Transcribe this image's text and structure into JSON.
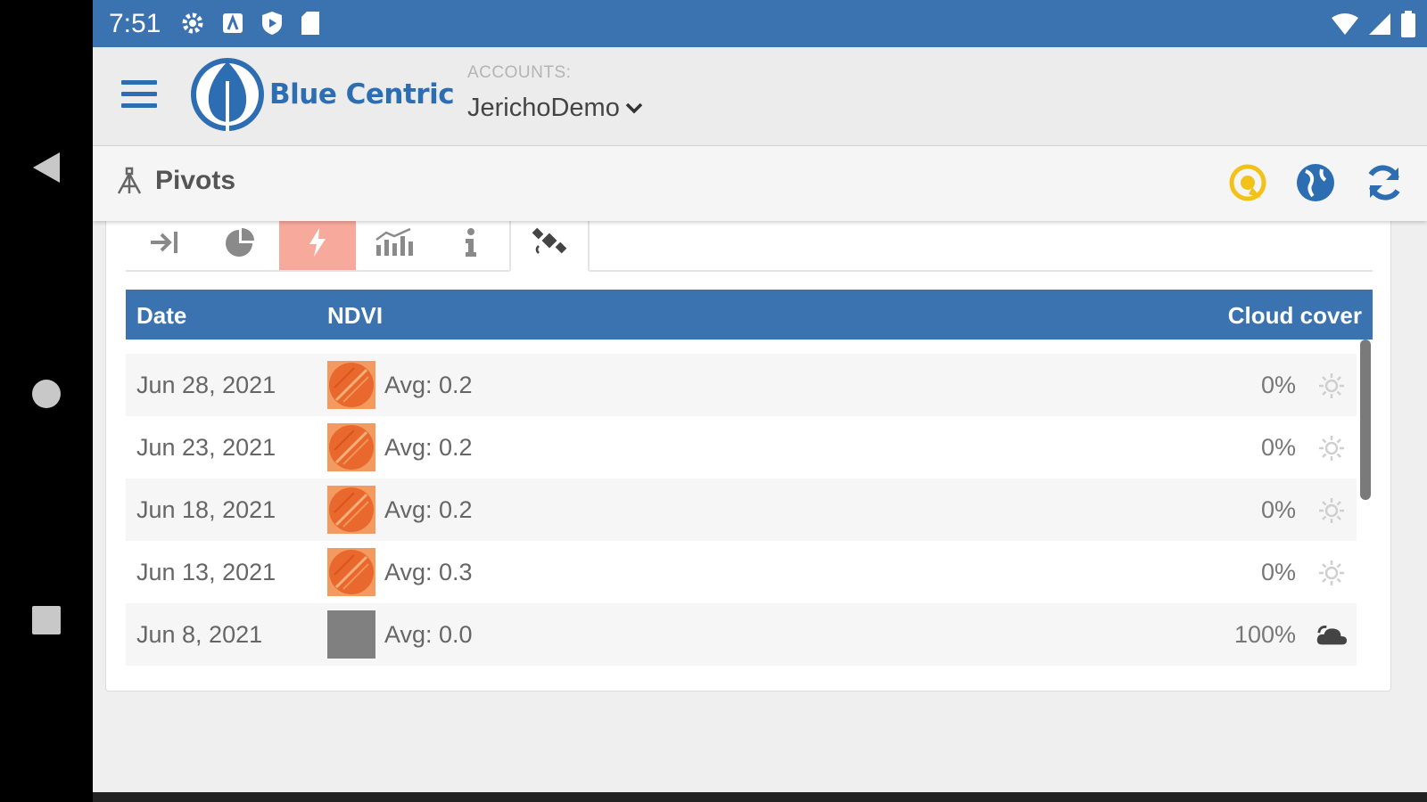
{
  "status_bar": {
    "time": "7:51"
  },
  "header": {
    "logo_text": "Blue Centric",
    "accounts_label": "ACCOUNTS:",
    "account_name": "JerichoDemo"
  },
  "pivots": {
    "title": "Pivots"
  },
  "table": {
    "columns": {
      "date": "Date",
      "ndvi": "NDVI",
      "cloud": "Cloud cover"
    },
    "rows": [
      {
        "date": "Jun 28, 2021",
        "avg": "Avg: 0.2",
        "cloud": "0%",
        "weather": "sunny-icon",
        "thumb": "ndvi-orange"
      },
      {
        "date": "Jun 23, 2021",
        "avg": "Avg: 0.2",
        "cloud": "0%",
        "weather": "sunny-icon",
        "thumb": "ndvi-orange"
      },
      {
        "date": "Jun 18, 2021",
        "avg": "Avg: 0.2",
        "cloud": "0%",
        "weather": "sunny-icon",
        "thumb": "ndvi-orange"
      },
      {
        "date": "Jun 13, 2021",
        "avg": "Avg: 0.3",
        "cloud": "0%",
        "weather": "sunny-icon",
        "thumb": "ndvi-orange"
      },
      {
        "date": "Jun 8, 2021",
        "avg": "Avg: 0.0",
        "cloud": "100%",
        "weather": "cloudy-icon",
        "thumb": "ndvi-gray"
      }
    ]
  },
  "colors": {
    "brand_blue": "#3b72b0",
    "active_tab": "#f7a99c",
    "alert_yellow": "#f2c21b",
    "ndvi_orange": "#e8682e",
    "ndvi_gray": "#808080"
  }
}
